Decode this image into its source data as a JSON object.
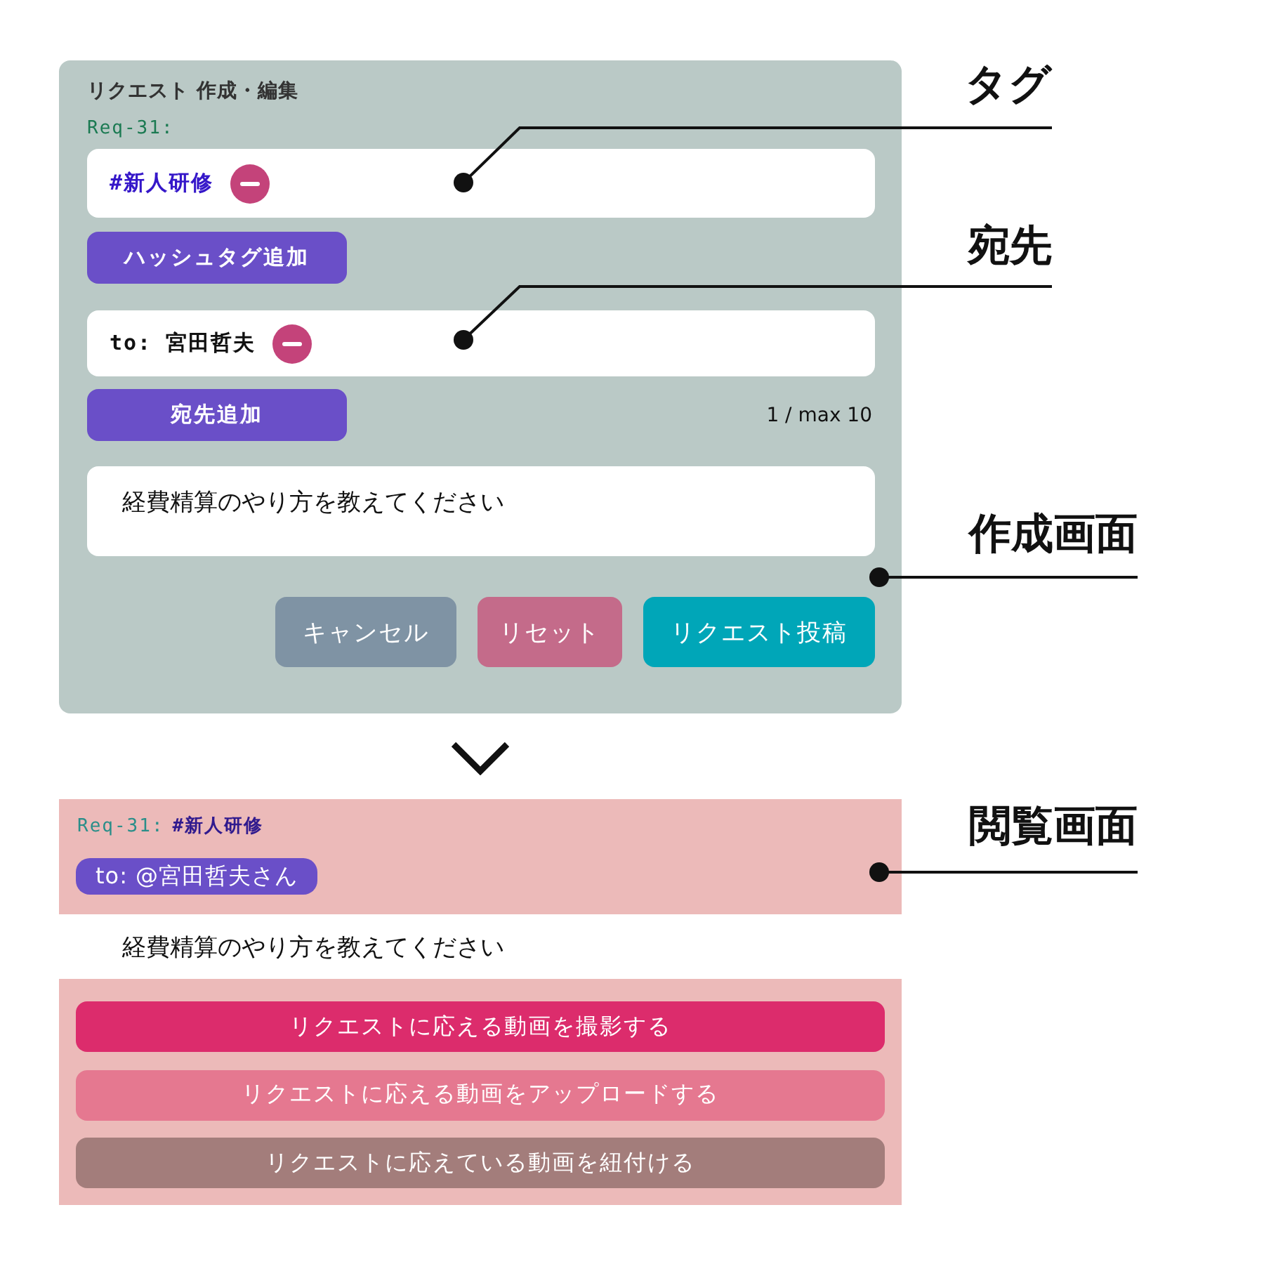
{
  "editor": {
    "title": "リクエスト 作成・編集",
    "request_id": "Req-31:",
    "tags": [
      "#新人研修"
    ],
    "add_tag_button": "ハッシュタグ追加",
    "recipients": [
      "to: 宮田哲夫"
    ],
    "add_recipient_button": "宛先追加",
    "recipient_count": "1 / max 10",
    "message": "経費精算のやり方を教えてください",
    "buttons": [
      {
        "label": "キャンセル",
        "kind": "cancel"
      },
      {
        "label": "リセット",
        "kind": "reset"
      },
      {
        "label": "リクエスト投稿",
        "kind": "submit"
      }
    ]
  },
  "viewer": {
    "request_id": "Req-31:",
    "tag": "#新人研修",
    "recipient": "to: @宮田哲夫さん",
    "message": "経費精算のやり方を教えてください",
    "actions": [
      {
        "label": "リクエストに応える動画を撮影する",
        "kind": "record"
      },
      {
        "label": "リクエストに応える動画をアップロードする",
        "kind": "upload"
      },
      {
        "label": "リクエストに応えている動画を紐付ける",
        "kind": "link"
      }
    ]
  },
  "annotations": [
    {
      "label": "タグ"
    },
    {
      "label": "宛先"
    },
    {
      "label": "作成画面"
    },
    {
      "label": "閲覧画面"
    }
  ]
}
